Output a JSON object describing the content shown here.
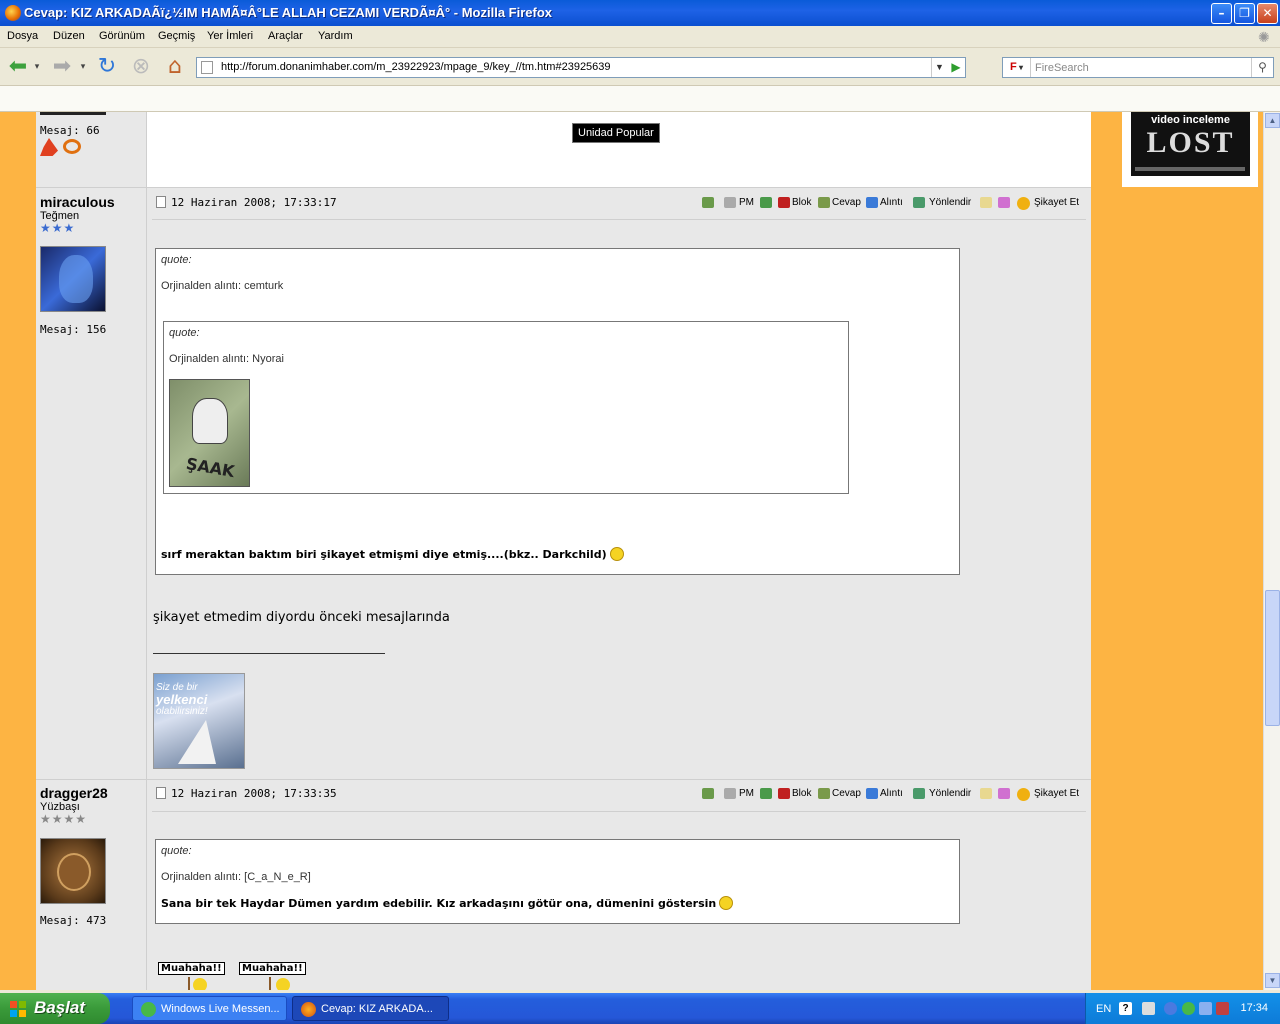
{
  "window": {
    "title": "Cevap: KIZ ARKADAÃï¿½IM HAMÃ¤Â°LE ALLAH CEZAMI VERDÃ¤Â°  - Mozilla Firefox"
  },
  "menu": [
    "Dosya",
    "Düzen",
    "Görünüm",
    "Geçmiş",
    "Yer İmleri",
    "Araçlar",
    "Yardım"
  ],
  "toolbar": {
    "url": "http://forum.donanimhaber.com/m_23922923/mpage_9/key_//tm.htm#23925639",
    "search_placeholder": "FireSearch",
    "search_engine_letter": "F"
  },
  "ad": {
    "line1": "video inceleme",
    "line2": "LOST"
  },
  "top_fragment": {
    "msg_count": "Mesaj: 66",
    "tooltip": "Unidad Popular"
  },
  "posts": [
    {
      "username": "miraculous",
      "rank": "Teğmen",
      "stars": "★★★",
      "msg_count": "Mesaj: 156",
      "date": "12 Haziran 2008; 17:33:17",
      "quote_label": "quote:",
      "quote_src": "Orjinalden alıntı: cemturk",
      "inner_quote_label": "quote:",
      "inner_quote_src": "Orjinalden alıntı: Nyorai",
      "inner_image_text": "ŞAAK",
      "quote_text": "sırf meraktan baktım biri şikayet etmişmi diye etmiş....(bkz.. Darkchild)",
      "body": "şikayet etmedim diyordu önceki mesajlarında",
      "signature_line1": "Siz de bir",
      "signature_line2": "yelkenci",
      "signature_line3": "olabilirsiniz!"
    },
    {
      "username": "dragger28",
      "rank": "Yüzbaşı",
      "stars": "★★★★",
      "msg_count": "Mesaj: 473",
      "date": "12 Haziran 2008; 17:33:35",
      "quote_label": "quote:",
      "quote_src": "Orjinalden alıntı: [C_a_N_e_R]",
      "quote_text": "Sana bir tek Haydar Dümen yardım edebilir. Kız arkadaşını götür ona, dümenini göstersin",
      "sign1": "Muahaha!!",
      "sign2": "Muahaha!!"
    }
  ],
  "actions": {
    "pm": "PM",
    "blok": "Blok",
    "cevap": "Cevap",
    "alinti": "Alıntı",
    "yonlendir": "Yönlendir",
    "sikayet": "Şikayet Et"
  },
  "taskbar": {
    "start": "Başlat",
    "tasks": [
      "Windows Live Messen...",
      "Cevap: KIZ ARKADA..."
    ],
    "lang": "EN",
    "clock": "17:34"
  },
  "colors": {
    "page_background": "#fdb443",
    "forum_background": "#e8e8e8",
    "title_bar": "#0a5bd8",
    "taskbar": "#245edc",
    "start_button": "#3a9a3a"
  }
}
